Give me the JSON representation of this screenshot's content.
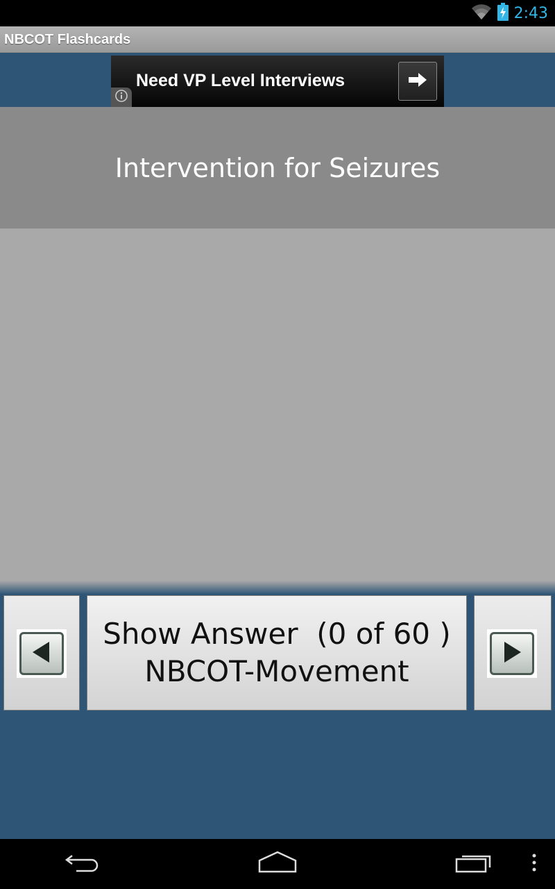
{
  "status_bar": {
    "time": "2:43",
    "icons": [
      "wifi-icon",
      "battery-charging-icon"
    ],
    "accent_color": "#33b5e5"
  },
  "action_bar": {
    "title": "NBCOT Flashcards"
  },
  "ad": {
    "text": "Need VP Level Interviews",
    "icons": [
      "arrow-right-icon",
      "info-icon"
    ]
  },
  "card": {
    "question": "Intervention for Seizures"
  },
  "controls": {
    "show_answer_line1": "Show Answer  (0 of 60 )",
    "show_answer_line2": "NBCOT-Movement",
    "prev_icon": "triangle-left-icon",
    "next_icon": "triangle-right-icon"
  },
  "system_nav": {
    "icons": [
      "back-icon",
      "home-icon",
      "recent-apps-icon",
      "overflow-menu-icon"
    ]
  },
  "colors": {
    "background": "#2e5576",
    "question_band": "#8a8a8a",
    "answer_area": "#a9a9a9"
  }
}
